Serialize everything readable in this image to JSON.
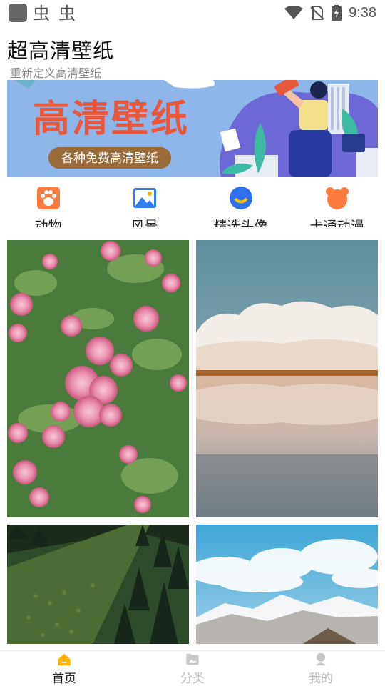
{
  "status_bar": {
    "time": "9:38"
  },
  "header": {
    "title": "超高清壁纸",
    "subtitle": "重新定义高清壁纸"
  },
  "banner": {
    "headline": "高清壁纸",
    "tagline": "各种免费高清壁纸"
  },
  "categories": [
    {
      "label": "动物",
      "icon": "paw-icon",
      "color": "#ff7a3d"
    },
    {
      "label": "风景",
      "icon": "landscape-image-icon",
      "color": "#2f7cf6"
    },
    {
      "label": "精选头像",
      "icon": "avatar-icon",
      "color": "#2f6ff0"
    },
    {
      "label": "卡通动漫",
      "icon": "cartoon-bear-icon",
      "color": "#ff7a3d"
    }
  ],
  "wallpapers": [
    {
      "subject": "pink-roses"
    },
    {
      "subject": "lake-clouds-reflection"
    },
    {
      "subject": "forest-hillside"
    },
    {
      "subject": "snowy-mountains-sky"
    }
  ],
  "bottom_nav": [
    {
      "label": "首页",
      "icon": "home-icon",
      "active": true
    },
    {
      "label": "分类",
      "icon": "category-icon",
      "active": false
    },
    {
      "label": "我的",
      "icon": "profile-icon",
      "active": false
    }
  ],
  "colors": {
    "accent": "#ffb400",
    "banner_title": "#e8573a",
    "inactive": "#bbbbbb"
  }
}
